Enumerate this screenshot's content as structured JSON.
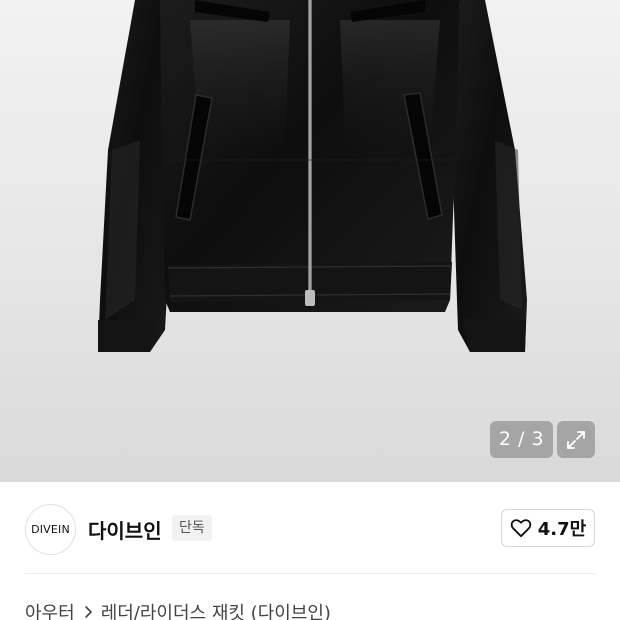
{
  "gallery": {
    "pager_text": "2 / 3"
  },
  "brand": {
    "logo_text": "DIVEIN",
    "name": "다이브인",
    "badge": "단독"
  },
  "like": {
    "count": "4.7만"
  },
  "breadcrumb": {
    "items": [
      "아우터",
      "레더/라이더스 재킷 (다이브인)"
    ]
  },
  "colors": {
    "overlay": "#787878",
    "text": "#111111",
    "badge_bg": "#f1f1f1"
  }
}
